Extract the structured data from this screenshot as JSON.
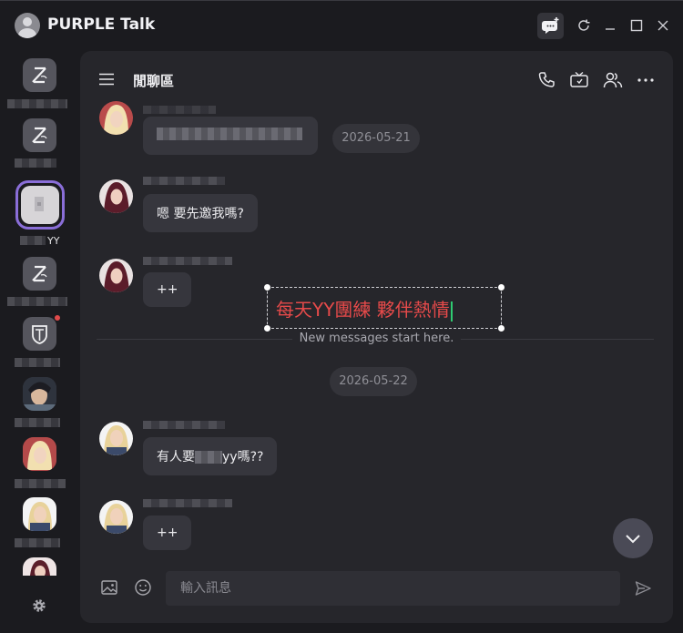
{
  "app": {
    "title": "PURPLE Talk"
  },
  "titlebar": {
    "icons": [
      "new-chat-icon",
      "refresh-icon",
      "minimize-icon",
      "maximize-icon",
      "close-icon"
    ]
  },
  "rail": {
    "selected_room_suffix": "YY",
    "unread_dot_color": "#e04a4a",
    "selected_border_color": "#8a6ed8"
  },
  "chat": {
    "room_title": "閒聊區",
    "header_icons": [
      "phone-icon",
      "tv-icon",
      "members-icon",
      "more-icon"
    ],
    "messages": [
      {
        "text": "",
        "date_pill": "2026-05-21"
      },
      {
        "text": "嗯  要先邀我嗎?"
      },
      {
        "text": "++"
      },
      {
        "text_prefix": "有人要",
        "text_suffix": "yy嗎??"
      },
      {
        "text": "++"
      }
    ],
    "new_messages_label": "New messages start here.",
    "date_divider": "2026-05-22"
  },
  "overlay": {
    "text": "每天YY團練  夥伴熱情",
    "color": "#e64a4a"
  },
  "composer": {
    "placeholder": "輸入訊息"
  }
}
